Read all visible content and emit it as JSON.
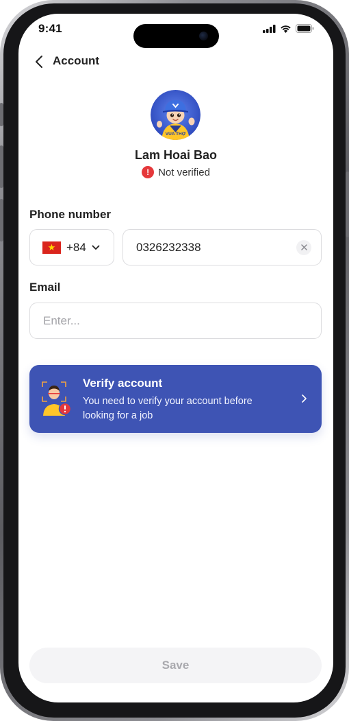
{
  "status_bar": {
    "time": "9:41"
  },
  "header": {
    "title": "Account"
  },
  "profile": {
    "name": "Lam Hoai Bao",
    "verification_status": "Not verified",
    "avatar_logo_text": "VUA THỢ"
  },
  "form": {
    "phone_label": "Phone number",
    "country_code": "+84",
    "phone_value": "0326232338",
    "email_label": "Email",
    "email_placeholder": "Enter..."
  },
  "verify_card": {
    "title": "Verify account",
    "description": "You need to verify your account before looking for a job"
  },
  "actions": {
    "save_label": "Save"
  },
  "colors": {
    "primary": "#3e54b4",
    "alert": "#e5383b",
    "flag_red": "#da251d",
    "flag_star": "#ffd700"
  },
  "icons": [
    "back-icon",
    "alert-icon",
    "flag-vn-icon",
    "chevron-down-icon",
    "clear-icon",
    "face-verify-icon",
    "chevron-right-icon",
    "signal-icon",
    "wifi-icon",
    "battery-icon"
  ]
}
